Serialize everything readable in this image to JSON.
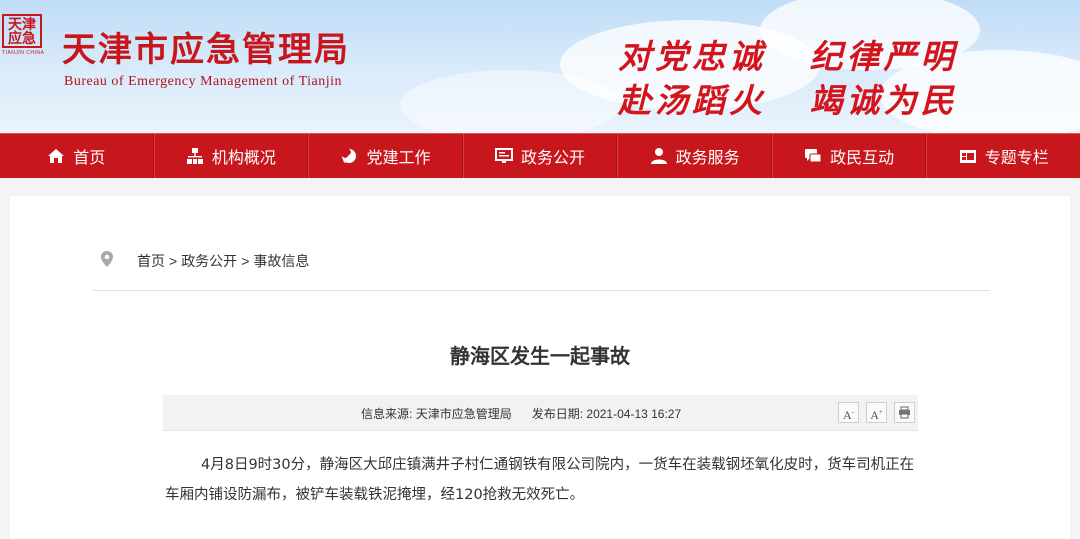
{
  "header": {
    "seal_text": "天津\n应急",
    "seal_sub": "TIANJIN CHINA",
    "title": "天津市应急管理局",
    "subtitle": "Bureau of Emergency Management of Tianjin",
    "slogan_line1": "对党忠诚 纪律严明",
    "slogan_line2": "赴汤蹈火 竭诚为民",
    "accent_color": "#c8161d"
  },
  "nav": {
    "items": [
      {
        "label": "首页",
        "icon": "home-icon"
      },
      {
        "label": "机构概况",
        "icon": "org-chart-icon"
      },
      {
        "label": "党建工作",
        "icon": "party-emblem-icon"
      },
      {
        "label": "政务公开",
        "icon": "monitor-icon"
      },
      {
        "label": "政务服务",
        "icon": "person-icon"
      },
      {
        "label": "政民互动",
        "icon": "chat-icon"
      },
      {
        "label": "专题专栏",
        "icon": "film-icon"
      }
    ]
  },
  "breadcrumb": {
    "home": "首页",
    "sep1": ">",
    "section": "政务公开",
    "sep2": ">",
    "current": "事故信息"
  },
  "article": {
    "title": "静海区发生一起事故",
    "source_label": "信息来源:",
    "source": "天津市应急管理局",
    "date_label": "发布日期:",
    "date": "2021-04-13 16:27",
    "font_decrease": "A",
    "font_increase": "A",
    "body": "4月8日9时30分，静海区大邱庄镇满井子村仁通钢铁有限公司院内，一货车在装载钢坯氧化皮时，货车司机正在车厢内铺设防漏布，被铲车装载铁泥掩埋，经120抢救无效死亡。"
  }
}
